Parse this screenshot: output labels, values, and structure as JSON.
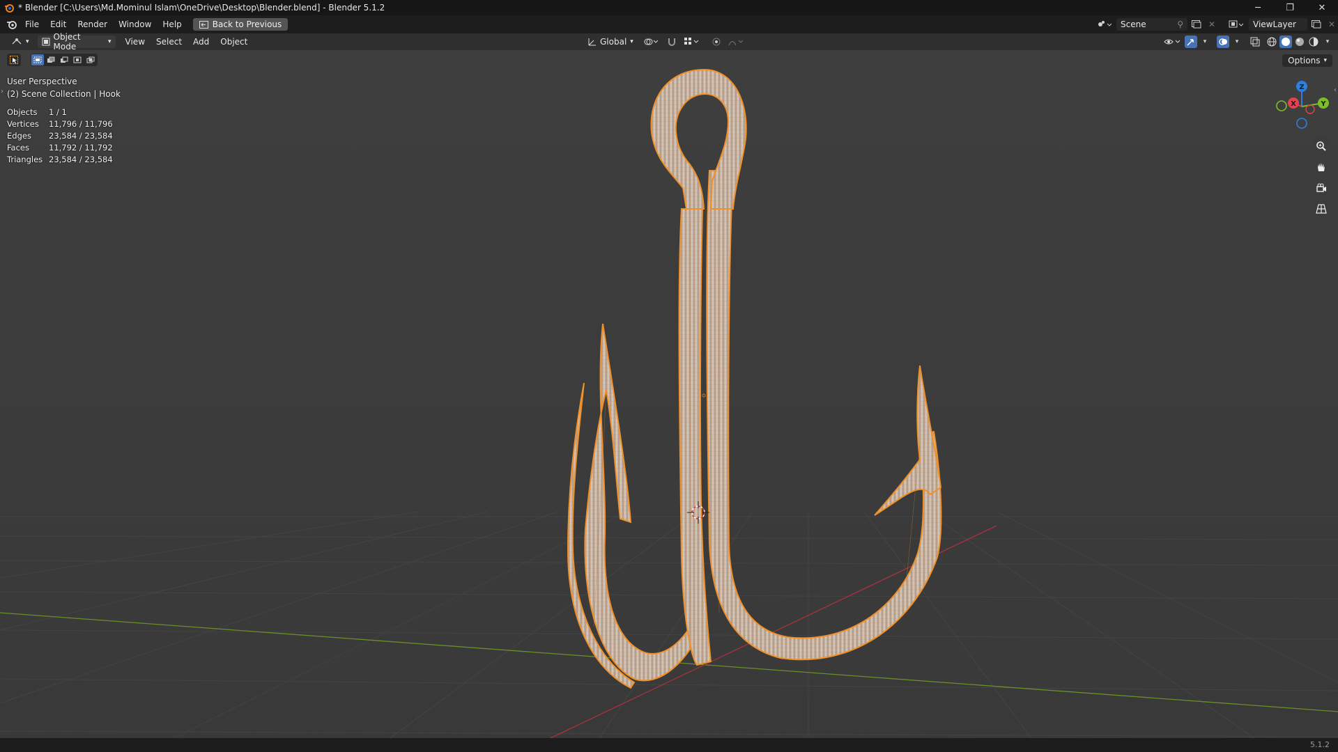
{
  "window": {
    "title": "* Blender [C:\\Users\\Md.Mominul Islam\\OneDrive\\Desktop\\Blender.blend] - Blender 5.1.2",
    "minimize_glyph": "─",
    "maximize_glyph": "❐",
    "close_glyph": "✕"
  },
  "menubar": {
    "items": [
      "File",
      "Edit",
      "Render",
      "Window",
      "Help"
    ],
    "back_button": "Back to Previous",
    "scene": "Scene",
    "view_layer": "ViewLayer"
  },
  "header": {
    "mode": "Object Mode",
    "menus": [
      "View",
      "Select",
      "Add",
      "Object"
    ],
    "transform_orientation": "Global"
  },
  "viewport": {
    "perspective": "User Perspective",
    "collection": "(2) Scene Collection | Hook",
    "options_label": "Options",
    "stats": [
      {
        "label": "Objects",
        "value": "1 / 1"
      },
      {
        "label": "Vertices",
        "value": "11,796 / 11,796"
      },
      {
        "label": "Edges",
        "value": "23,584 / 23,584"
      },
      {
        "label": "Faces",
        "value": "11,792 / 11,792"
      },
      {
        "label": "Triangles",
        "value": "23,584 / 23,584"
      }
    ],
    "gizmo": {
      "z": "Z",
      "x": "X",
      "y": "Y"
    }
  },
  "status": {
    "version": "5.1.2"
  },
  "colors": {
    "accent": "#4772b3",
    "selection_outline": "#f0902a",
    "x_axis": "#e0424f",
    "y_axis": "#7cbf2a",
    "z_axis": "#2f7fe0"
  }
}
